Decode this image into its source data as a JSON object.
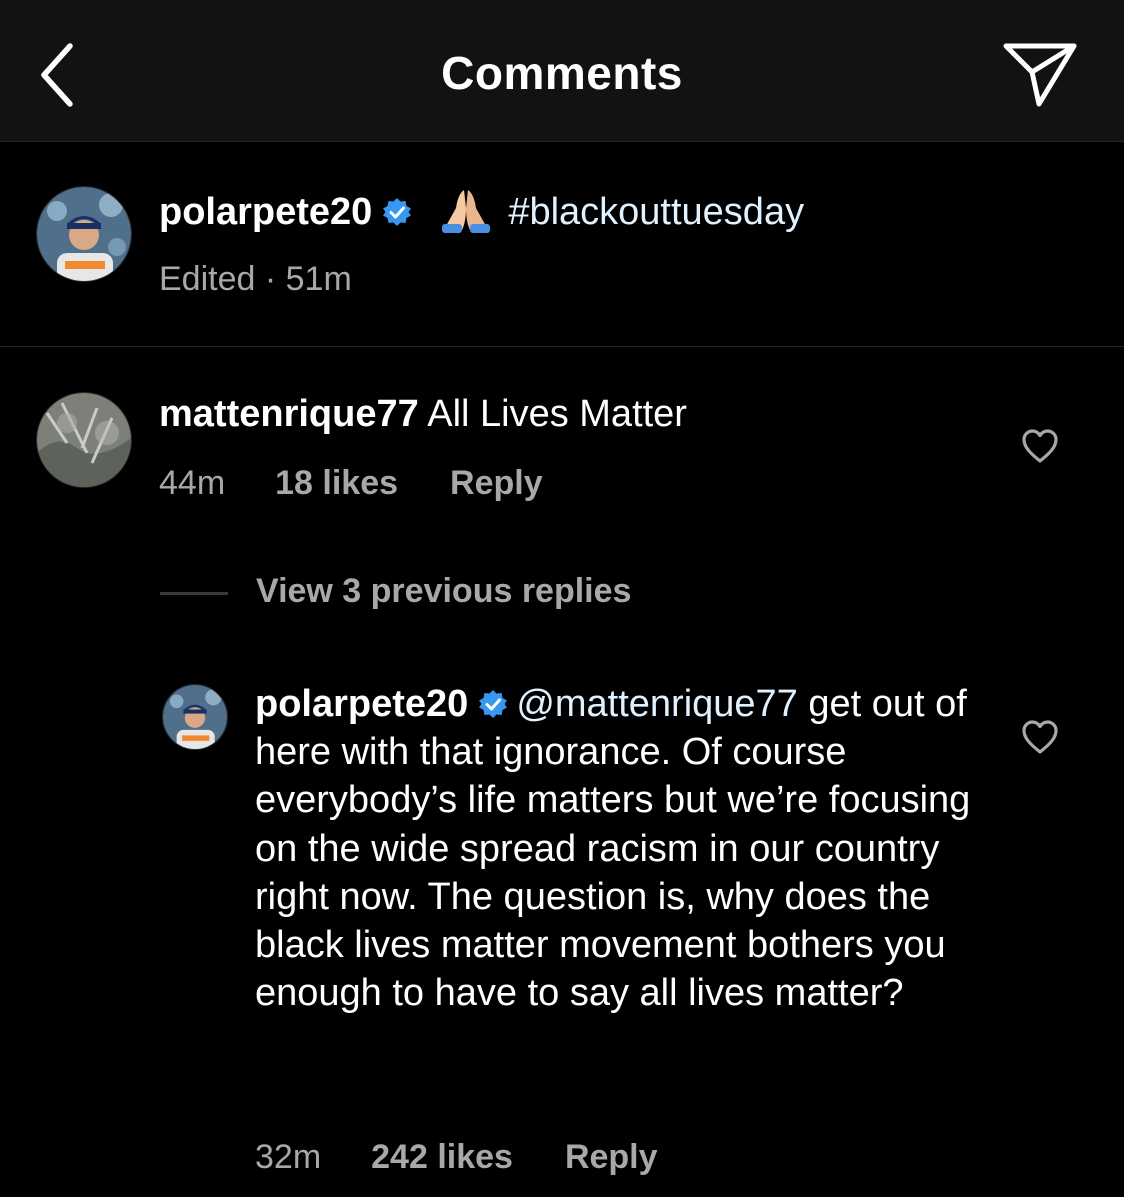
{
  "header": {
    "title": "Comments",
    "back_icon": "chevron-left-icon",
    "send_icon": "paper-plane-icon"
  },
  "caption": {
    "username": "polarpete20",
    "verified": true,
    "emoji": "🙏🏻",
    "hashtag": "#blackouttuesday",
    "meta": "Edited · 51m"
  },
  "comment": {
    "username": "mattenrique77",
    "text": "All Lives Matter",
    "time": "44m",
    "likes": "18 likes",
    "reply_label": "Reply"
  },
  "view_replies": "View 3 previous replies",
  "reply": {
    "username": "polarpete20",
    "verified": true,
    "mention": "@mattenrique77",
    "text": " get out of here with that ignorance. Of course everybody’s life matters but we’re focusing on the wide spread racism in our country right now. The question is, why does the black lives matter movement bothers you enough to have to say all lives matter?",
    "time": "32m",
    "likes": "242 likes",
    "reply_label": "Reply"
  },
  "colors": {
    "background": "#000000",
    "header_bg": "#121212",
    "secondary_text": "#a8a8a8",
    "verified_blue": "#3897f0",
    "hashtag": "#e0f1ff"
  }
}
